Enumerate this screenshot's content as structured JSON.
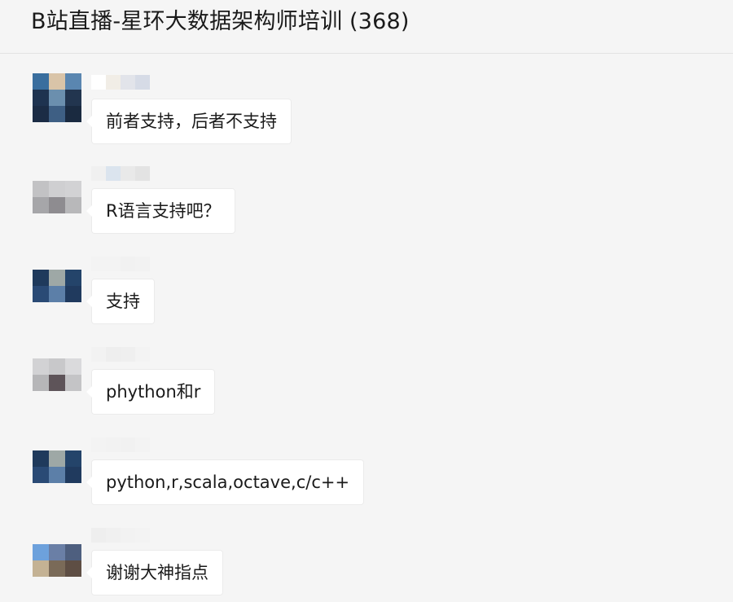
{
  "window": {
    "title": "B站直播-星环大数据架构师培训 (368)"
  },
  "messages": [
    {
      "text": "前者支持，后者不支持",
      "avatar_colors": [
        "#3a6e9e",
        "#d9c4a8",
        "#5a86b0",
        "#1e3350",
        "#6b8fae",
        "#22354f",
        "#1b2c45",
        "#3e5f84",
        "#1a2a40"
      ],
      "nick_colors": [
        "#ffffff",
        "#f1ede6",
        "#e2e4ea",
        "#d6dbe6"
      ]
    },
    {
      "text": "R语言支持吧？",
      "avatar_colors": [
        "#c2c2c4",
        "#cfcfd1",
        "#d2d2d4",
        "#a6a6a9",
        "#8e8c90",
        "#b8b8ba"
      ],
      "nick_colors": [
        "#f0f0f0",
        "#dbe4ee",
        "#e9e9e9",
        "#e3e3e3"
      ]
    },
    {
      "text": "支持",
      "avatar_colors": [
        "#1f3a5c",
        "#9ea8a6",
        "#24446a",
        "#2a4a75",
        "#5c7fa8",
        "#203a5e"
      ],
      "nick_colors": [
        "#f3f3f3",
        "#f3f3f3",
        "#f1f1f1",
        "#f2f2f2"
      ]
    },
    {
      "text": "phython和r",
      "avatar_colors": [
        "#d2d2d4",
        "#c8c8ca",
        "#dadadc",
        "#b6b6b8",
        "#5e5459",
        "#c4c4c6"
      ],
      "nick_colors": [
        "#f2f2f2",
        "#eeeeee",
        "#efefef",
        "#f3f3f3"
      ]
    },
    {
      "text": "python,r,scala,octave,c/c++",
      "avatar_colors": [
        "#1f3a5c",
        "#9ea8a6",
        "#24446a",
        "#2a4a75",
        "#5c7fa8",
        "#203a5e"
      ],
      "nick_colors": [
        "#f3f3f3",
        "#f2f2f2",
        "#f1f1f1",
        "#f3f3f3"
      ]
    },
    {
      "text": "谢谢大神指点",
      "avatar_colors": [
        "#6da1dc",
        "#6a7fa6",
        "#4e5f7f",
        "#c4b294",
        "#7a6a58",
        "#5e4e44"
      ],
      "nick_colors": [
        "#eeeeee",
        "#f0f0f0",
        "#f2f2f2",
        "#f3f3f3"
      ]
    }
  ]
}
